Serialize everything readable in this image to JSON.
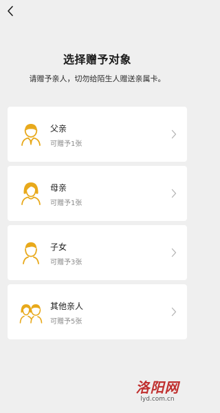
{
  "header": {
    "title": "选择赠予对象",
    "subtitle": "请赠予亲人，切勿给陌生人赠送亲属卡。"
  },
  "recipients": [
    {
      "name": "父亲",
      "count": "可赠予1张",
      "icon": "father-icon"
    },
    {
      "name": "母亲",
      "count": "可赠予1张",
      "icon": "mother-icon"
    },
    {
      "name": "子女",
      "count": "可赠予3张",
      "icon": "child-icon"
    },
    {
      "name": "其他亲人",
      "count": "可赠予5张",
      "icon": "relatives-icon"
    }
  ],
  "watermark": {
    "logo": "洛阳网",
    "url": "lyd.com.cn"
  },
  "colors": {
    "background": "#efefef",
    "card": "#ffffff",
    "icon_accent": "#e8a91b",
    "secondary_text": "#8a8a8a",
    "chevron": "#b5b5b5",
    "watermark_red": "#c0302f"
  }
}
